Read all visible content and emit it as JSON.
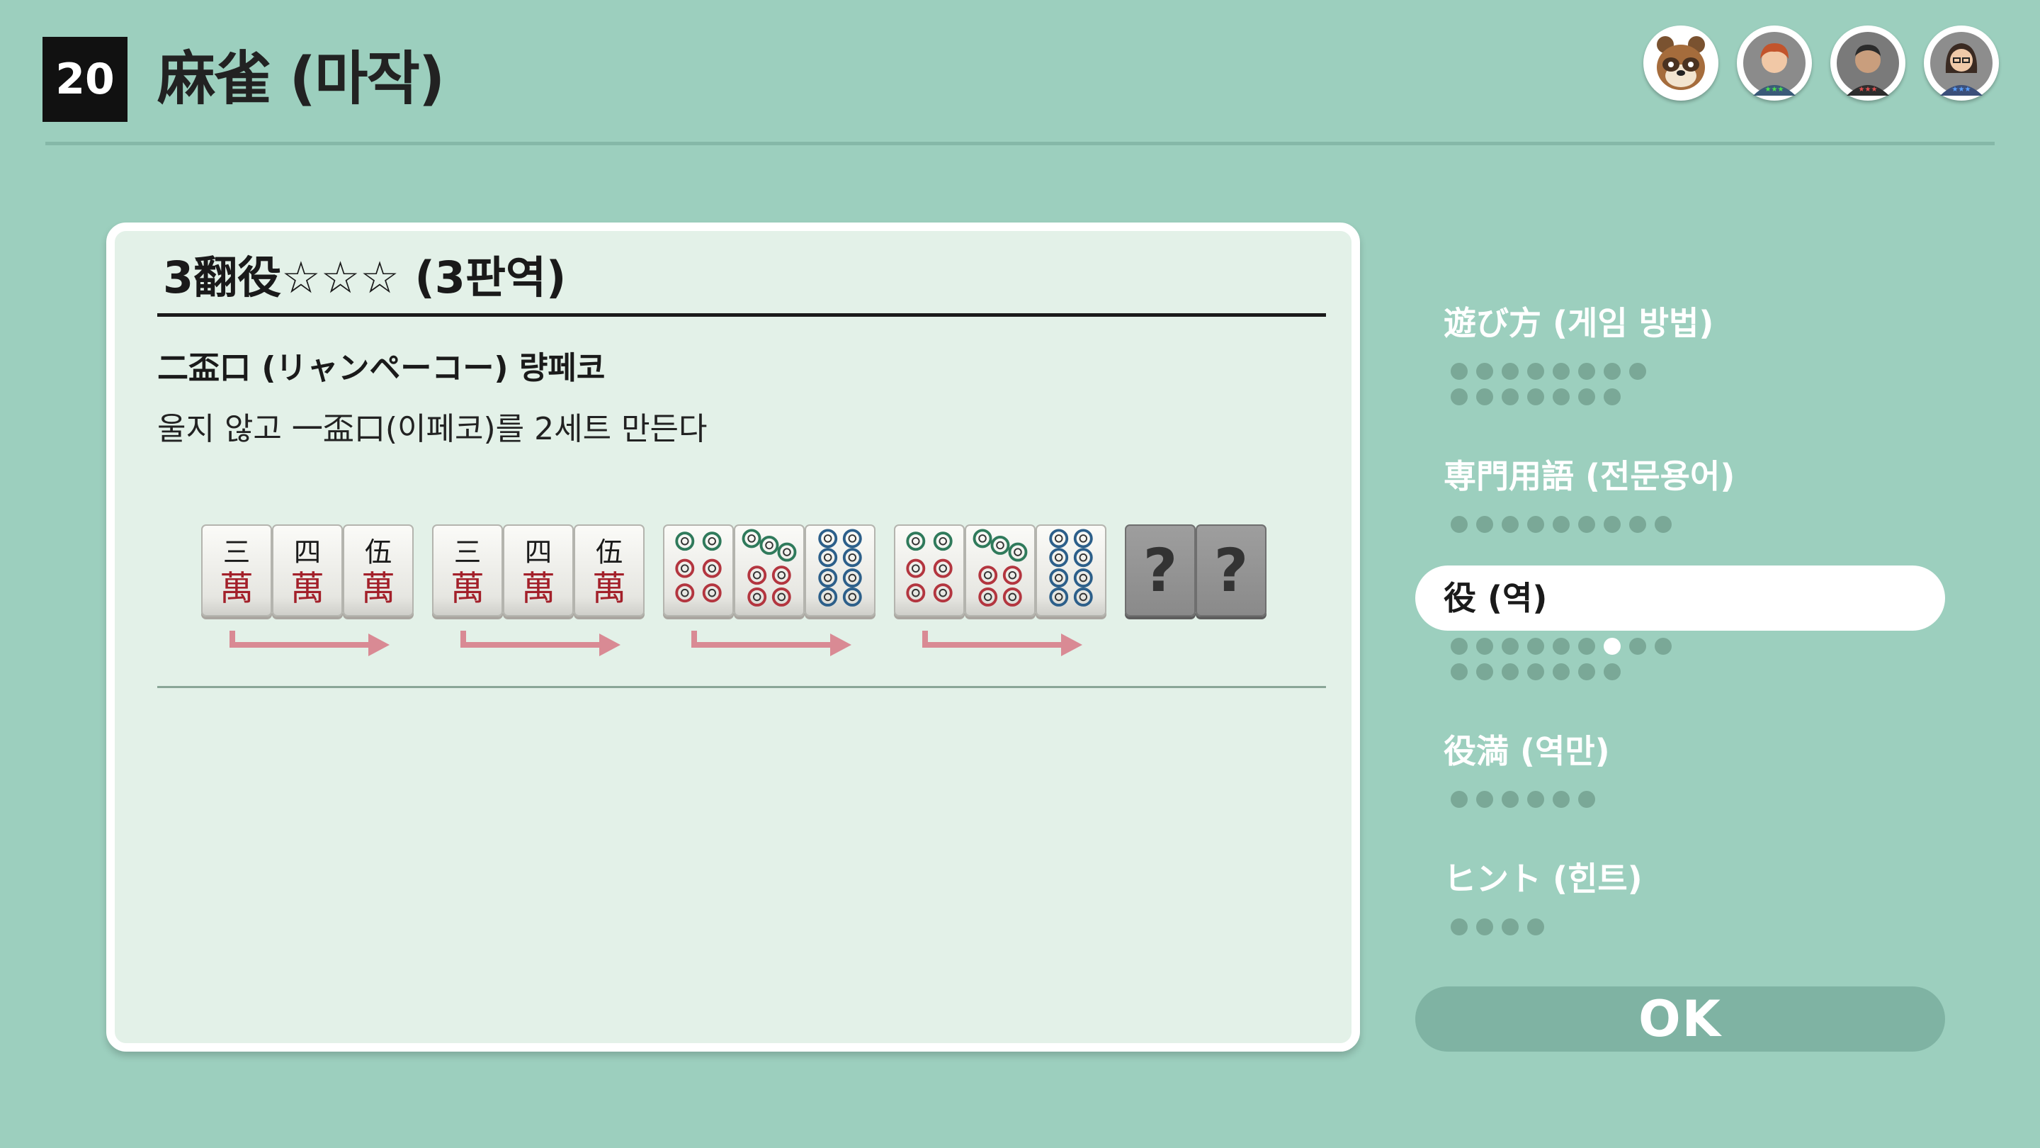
{
  "header": {
    "game_number": "20",
    "title": "麻雀 (마작)",
    "avatars": [
      "raccoon-avatar-icon",
      "player-avatar-icon",
      "player-avatar-icon",
      "player-avatar-icon"
    ]
  },
  "card": {
    "title": "3翻役☆☆☆ (3판역)",
    "yaku_name": "二盃口 (リャンペーコー) 량페코",
    "description": "울지 않고 一盃口(이페코)를 2세트 만든다",
    "tiles": [
      {
        "suit": "man",
        "rank": 3
      },
      {
        "suit": "man",
        "rank": 4
      },
      {
        "suit": "man",
        "rank": 5
      },
      {
        "suit": "man",
        "rank": 3
      },
      {
        "suit": "man",
        "rank": 4
      },
      {
        "suit": "man",
        "rank": 5
      },
      {
        "suit": "pin",
        "rank": 6
      },
      {
        "suit": "pin",
        "rank": 7
      },
      {
        "suit": "pin",
        "rank": 8
      },
      {
        "suit": "pin",
        "rank": 6
      },
      {
        "suit": "pin",
        "rank": 7
      },
      {
        "suit": "pin",
        "rank": 8
      },
      {
        "suit": "unknown",
        "label": "?"
      },
      {
        "suit": "unknown",
        "label": "?"
      }
    ],
    "arrow_color": "#d98a94"
  },
  "menu": {
    "items": [
      {
        "label": "遊び方 (게임 방법)",
        "dot_rows": [
          8,
          7
        ]
      },
      {
        "label": "専門用語 (전문용어)",
        "dot_rows": [
          9
        ]
      },
      {
        "label": "役 (역)",
        "dot_rows": [
          9,
          7
        ],
        "active": true,
        "current_dot": 6
      },
      {
        "label": "役満 (역만)",
        "dot_rows": [
          6
        ]
      },
      {
        "label": "ヒント (힌트)",
        "dot_rows": [
          4
        ]
      }
    ]
  },
  "ok_button": {
    "label": "OK"
  },
  "colors": {
    "background": "#9ccfbe",
    "card": "#e3f1e8",
    "accent": "#7fb3a3"
  }
}
